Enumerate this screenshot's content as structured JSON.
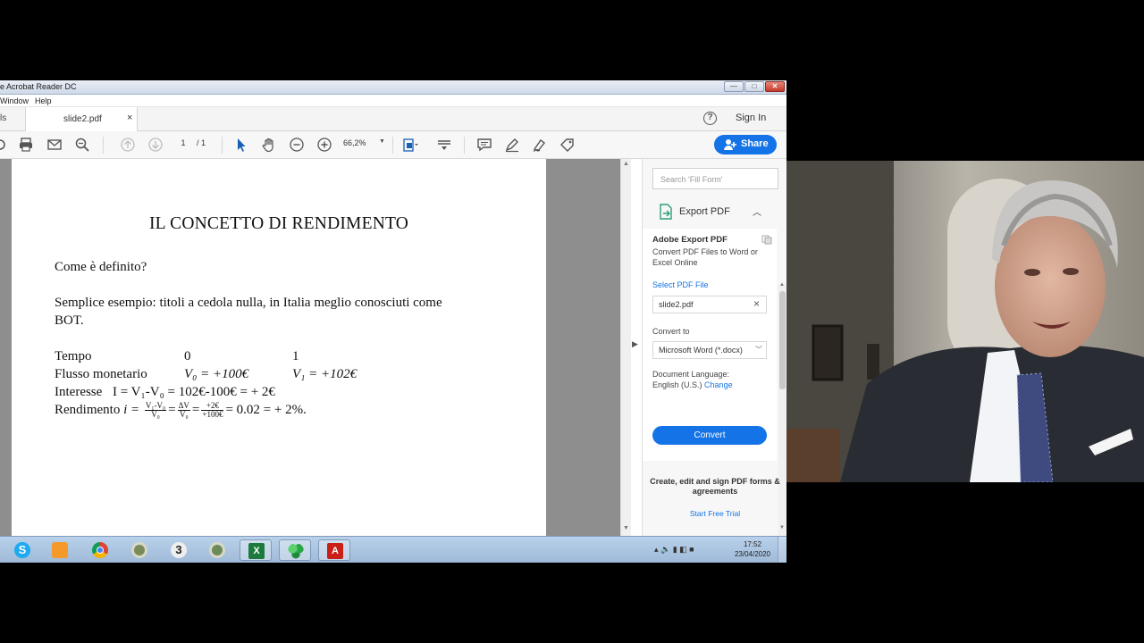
{
  "window": {
    "title": "e Acrobat Reader DC",
    "controls": {
      "minimize": "—",
      "maximize": "□",
      "close": "✕"
    }
  },
  "menu": [
    "Window",
    "Help"
  ],
  "tabs": {
    "tools_partial": "ls",
    "file_tab": "slide2.pdf",
    "close": "×",
    "help": "?",
    "sign_in": "Sign In"
  },
  "toolbar": {
    "page_current": "1",
    "page_total": "/ 1",
    "zoom": "66,2%",
    "share": "Share",
    "icons": [
      "print-icon",
      "mail-icon",
      "zoom-out-search-icon",
      "page-up-icon",
      "page-down-icon",
      "select-cursor-icon",
      "hand-icon",
      "zoom-minus-icon",
      "zoom-plus-icon",
      "fit-page-icon",
      "scroll-mode-icon",
      "comment-icon",
      "highlight-icon",
      "sign-icon",
      "more-tools-icon"
    ]
  },
  "document": {
    "title": "IL CONCETTO DI RENDIMENTO",
    "question": "Come è definito?",
    "example_line1": "Semplice esempio: titoli a cedola nulla, in Italia meglio conosciuti come",
    "example_line2": "BOT.",
    "row_tempo": {
      "label": "Tempo",
      "t0": "0",
      "t1": "1"
    },
    "row_flusso": {
      "label": "Flusso monetario",
      "v0": "V₀ = +100€",
      "v1": "V₁ = +102€"
    },
    "row_interesse": {
      "label": "Interesse",
      "formula": "I = V₁-V₀ = 102€-100€ = + 2€"
    },
    "row_rendimento": {
      "label": "Rendimento",
      "lhs": "i = ",
      "frac1_num": "V₁-V₀",
      "frac1_den": "V₀",
      "frac2_num": "ΔV",
      "frac2_den": "V₀",
      "frac3_num": "+2€",
      "frac3_den": "+100€",
      "tail": "= 0.02 = + 2%."
    }
  },
  "right_pane": {
    "search_placeholder": "Search 'Fill Form'",
    "export_header": "Export PDF",
    "export_title": "Adobe Export PDF",
    "export_desc": "Convert PDF Files to Word or Excel Online",
    "select_file": "Select PDF File",
    "file_name": "slide2.pdf",
    "convert_to_label": "Convert to",
    "format": "Microsoft Word (*.docx)",
    "doc_language_label": "Document Language:",
    "language": "English (U.S.)",
    "change": "Change",
    "convert_button": "Convert",
    "promo": "Create, edit and sign PDF forms & agreements",
    "promo_link": "Start Free Trial"
  },
  "taskbar": {
    "apps": [
      "skype-icon",
      "media-player-icon",
      "chrome-icon",
      "circle-app-icon",
      "three-app-icon",
      "circle-app-2-icon",
      "excel-icon",
      "green-app-icon",
      "acrobat-icon"
    ],
    "time": "17:52",
    "date": "23/04/2020",
    "tray": "▴ 🔈 ▮ ◧ ■"
  },
  "colors": {
    "accent": "#1473e6",
    "taskbar": "#a9c3e0",
    "doc_bg": "#8e8e8e"
  }
}
